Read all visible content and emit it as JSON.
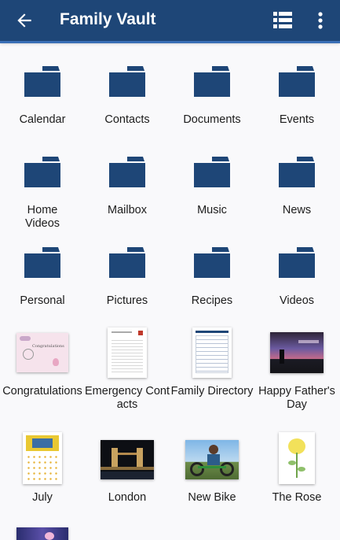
{
  "app": {
    "title": "Family Vault",
    "colors": {
      "toolbar": "#1e4677",
      "accent": "#3a6fb6",
      "folder": "#1e4677",
      "background": "#f9f9fb"
    }
  },
  "toolbar": {
    "back_icon": "arrow-left-icon",
    "view_icon": "list-view-icon",
    "more_icon": "more-vertical-icon"
  },
  "folders": [
    {
      "label": "Calendar",
      "icon": "folder-icon"
    },
    {
      "label": "Contacts",
      "icon": "folder-icon"
    },
    {
      "label": "Documents",
      "icon": "folder-icon"
    },
    {
      "label": "Events",
      "icon": "folder-icon"
    },
    {
      "label": "Home Videos",
      "icon": "folder-icon"
    },
    {
      "label": "Mailbox",
      "icon": "folder-icon"
    },
    {
      "label": "Music",
      "icon": "folder-icon"
    },
    {
      "label": "News",
      "icon": "folder-icon"
    },
    {
      "label": "Personal",
      "icon": "folder-icon"
    },
    {
      "label": "Pictures",
      "icon": "folder-icon"
    },
    {
      "label": "Recipes",
      "icon": "folder-icon"
    },
    {
      "label": "Videos",
      "icon": "folder-icon"
    }
  ],
  "files": [
    {
      "label": "Congratulations",
      "thumb_text": "Congratulations"
    },
    {
      "label": "Emergency Contacts"
    },
    {
      "label": "Family Directory"
    },
    {
      "label": "Happy Father's Day"
    },
    {
      "label": "July"
    },
    {
      "label": "London"
    },
    {
      "label": "New Bike"
    },
    {
      "label": "The Rose"
    }
  ]
}
